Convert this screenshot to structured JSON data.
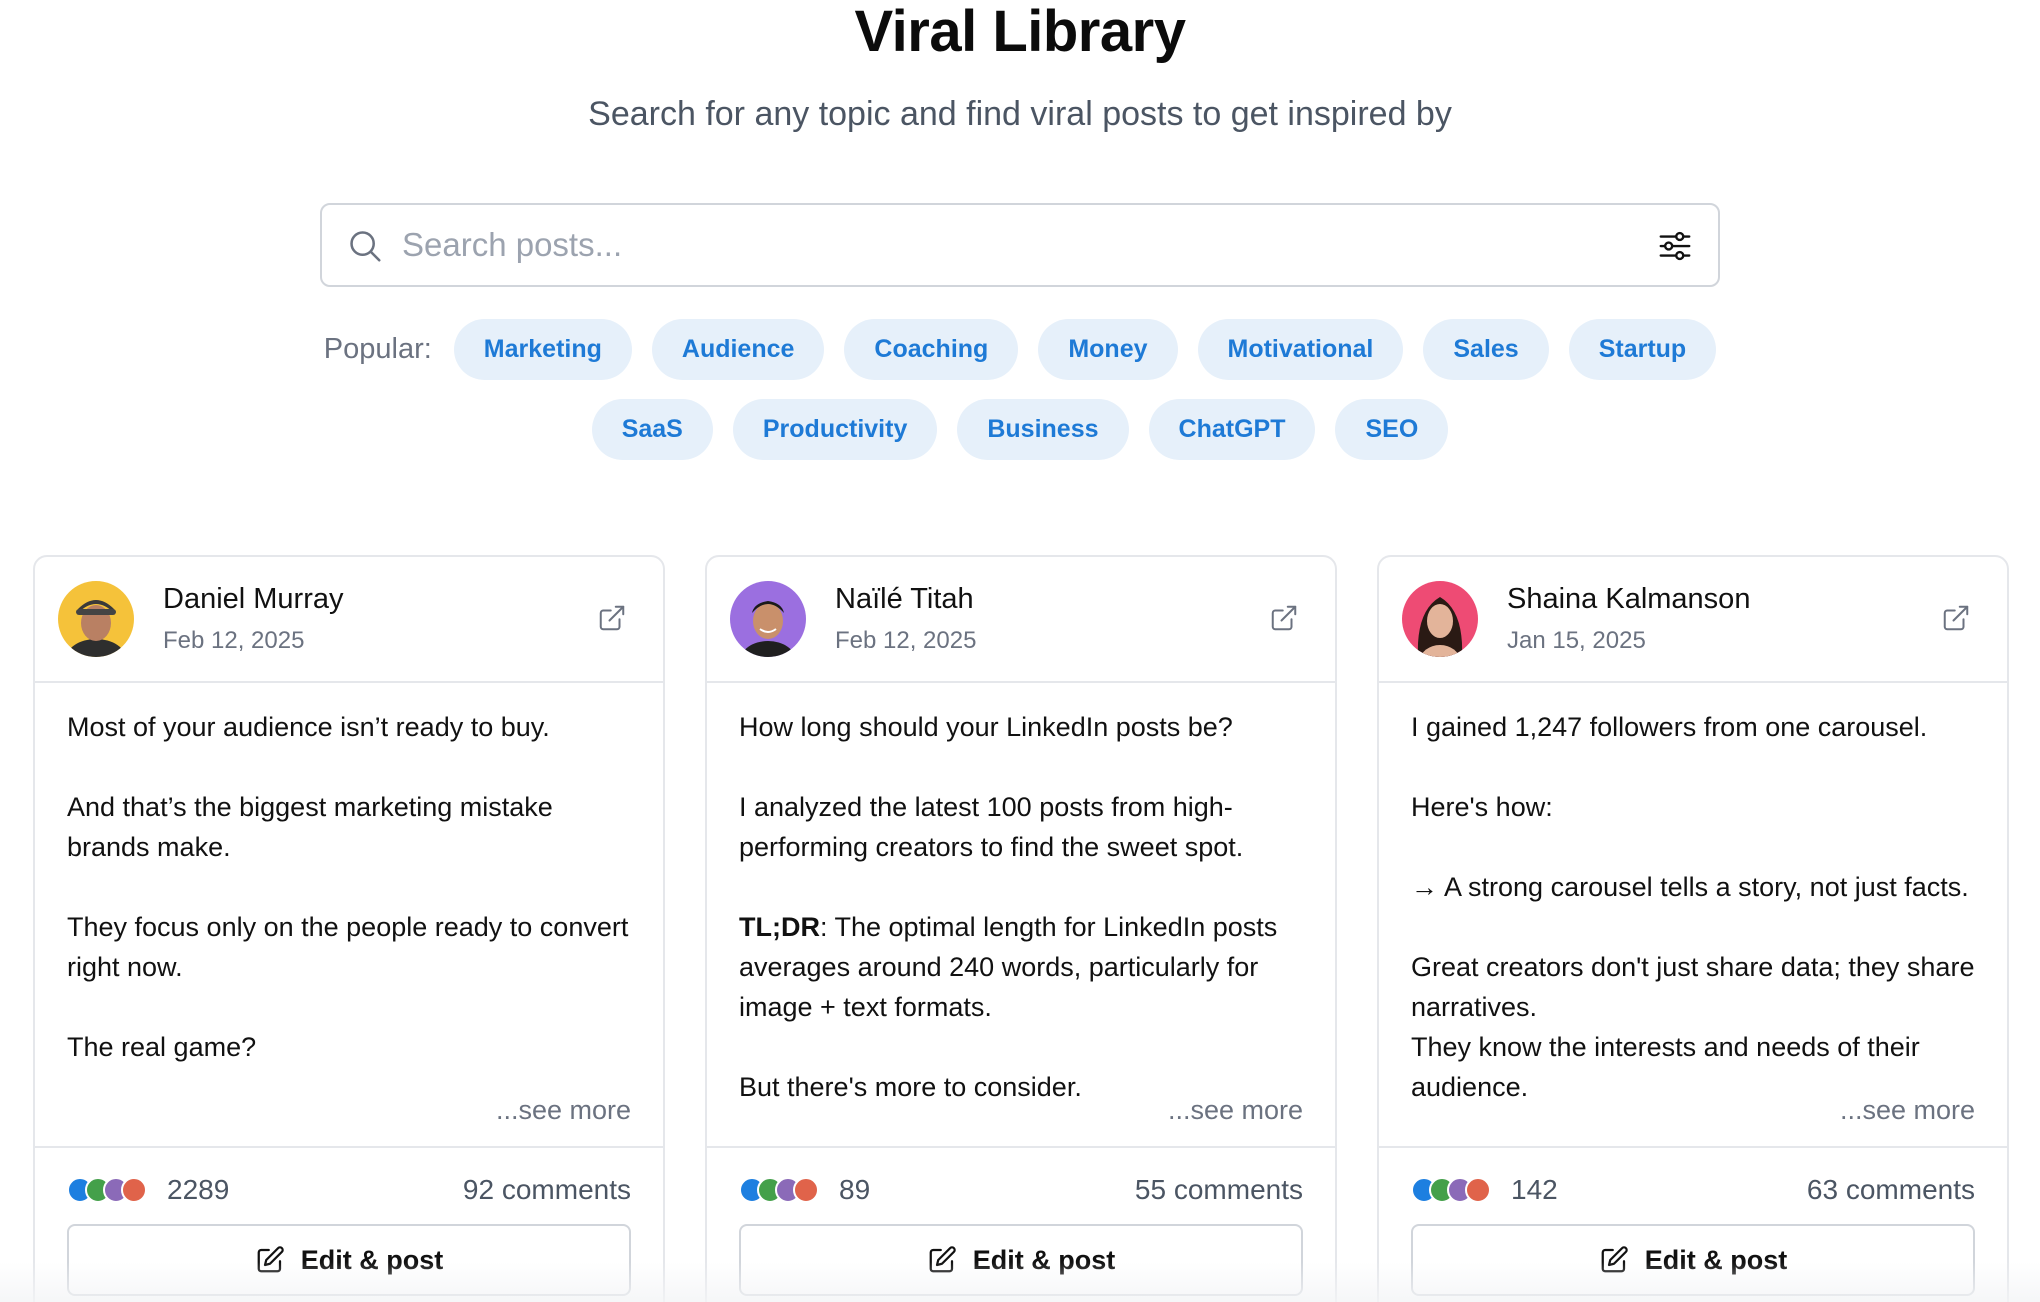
{
  "header": {
    "title": "Viral Library",
    "subtitle": "Search for any topic and find viral posts to get inspired by"
  },
  "search": {
    "placeholder": "Search posts...",
    "value": ""
  },
  "popular": {
    "label": "Popular:",
    "tags_row1": [
      "Marketing",
      "Audience",
      "Coaching",
      "Money",
      "Motivational",
      "Sales",
      "Startup"
    ],
    "tags_row2": [
      "SaaS",
      "Productivity",
      "Business",
      "ChatGPT",
      "SEO"
    ]
  },
  "colors": {
    "tag_bg": "#e6f0fa",
    "tag_text": "#1e7ad6",
    "like": "#1d7fe0",
    "celebrate": "#44a04a",
    "support": "#8b6ab8",
    "love": "#e0634a"
  },
  "posts": [
    {
      "author": "Daniel Murray",
      "date": "Feb 12, 2025",
      "lines": [
        "Most of your audience isn’t ready to buy.",
        "",
        "And that’s the biggest marketing mistake brands make.",
        "",
        "They focus only on the people ready to convert right now.",
        "",
        "The real game?"
      ],
      "see_more": "...see more",
      "reactions": "2289",
      "comments": "92 comments",
      "action": "Edit & post"
    },
    {
      "author": "Naïlé Titah",
      "date": "Feb 12, 2025",
      "lines": [
        "How long should your LinkedIn posts be?",
        "",
        "I analyzed the latest 100 posts from high-performing creators to find the sweet spot.",
        ""
      ],
      "bold_lead": "TL;DR",
      "bold_rest": ": The optimal length for LinkedIn posts averages around 240 words, particularly for image + text formats.",
      "tail": "But there's more to consider.",
      "see_more": "...see more",
      "reactions": "89",
      "comments": "55 comments",
      "action": "Edit & post"
    },
    {
      "author": "Shaina Kalmanson",
      "date": "Jan 15, 2025",
      "lines": [
        "I gained 1,247 followers from one carousel.",
        "",
        "Here's how:",
        "",
        "→ A strong carousel tells a story, not just facts.",
        "",
        "Great creators don't just share data; they share narratives.",
        "They know the interests and needs of their audience."
      ],
      "see_more": "...see more",
      "reactions": "142",
      "comments": "63 comments",
      "action": "Edit & post"
    }
  ]
}
